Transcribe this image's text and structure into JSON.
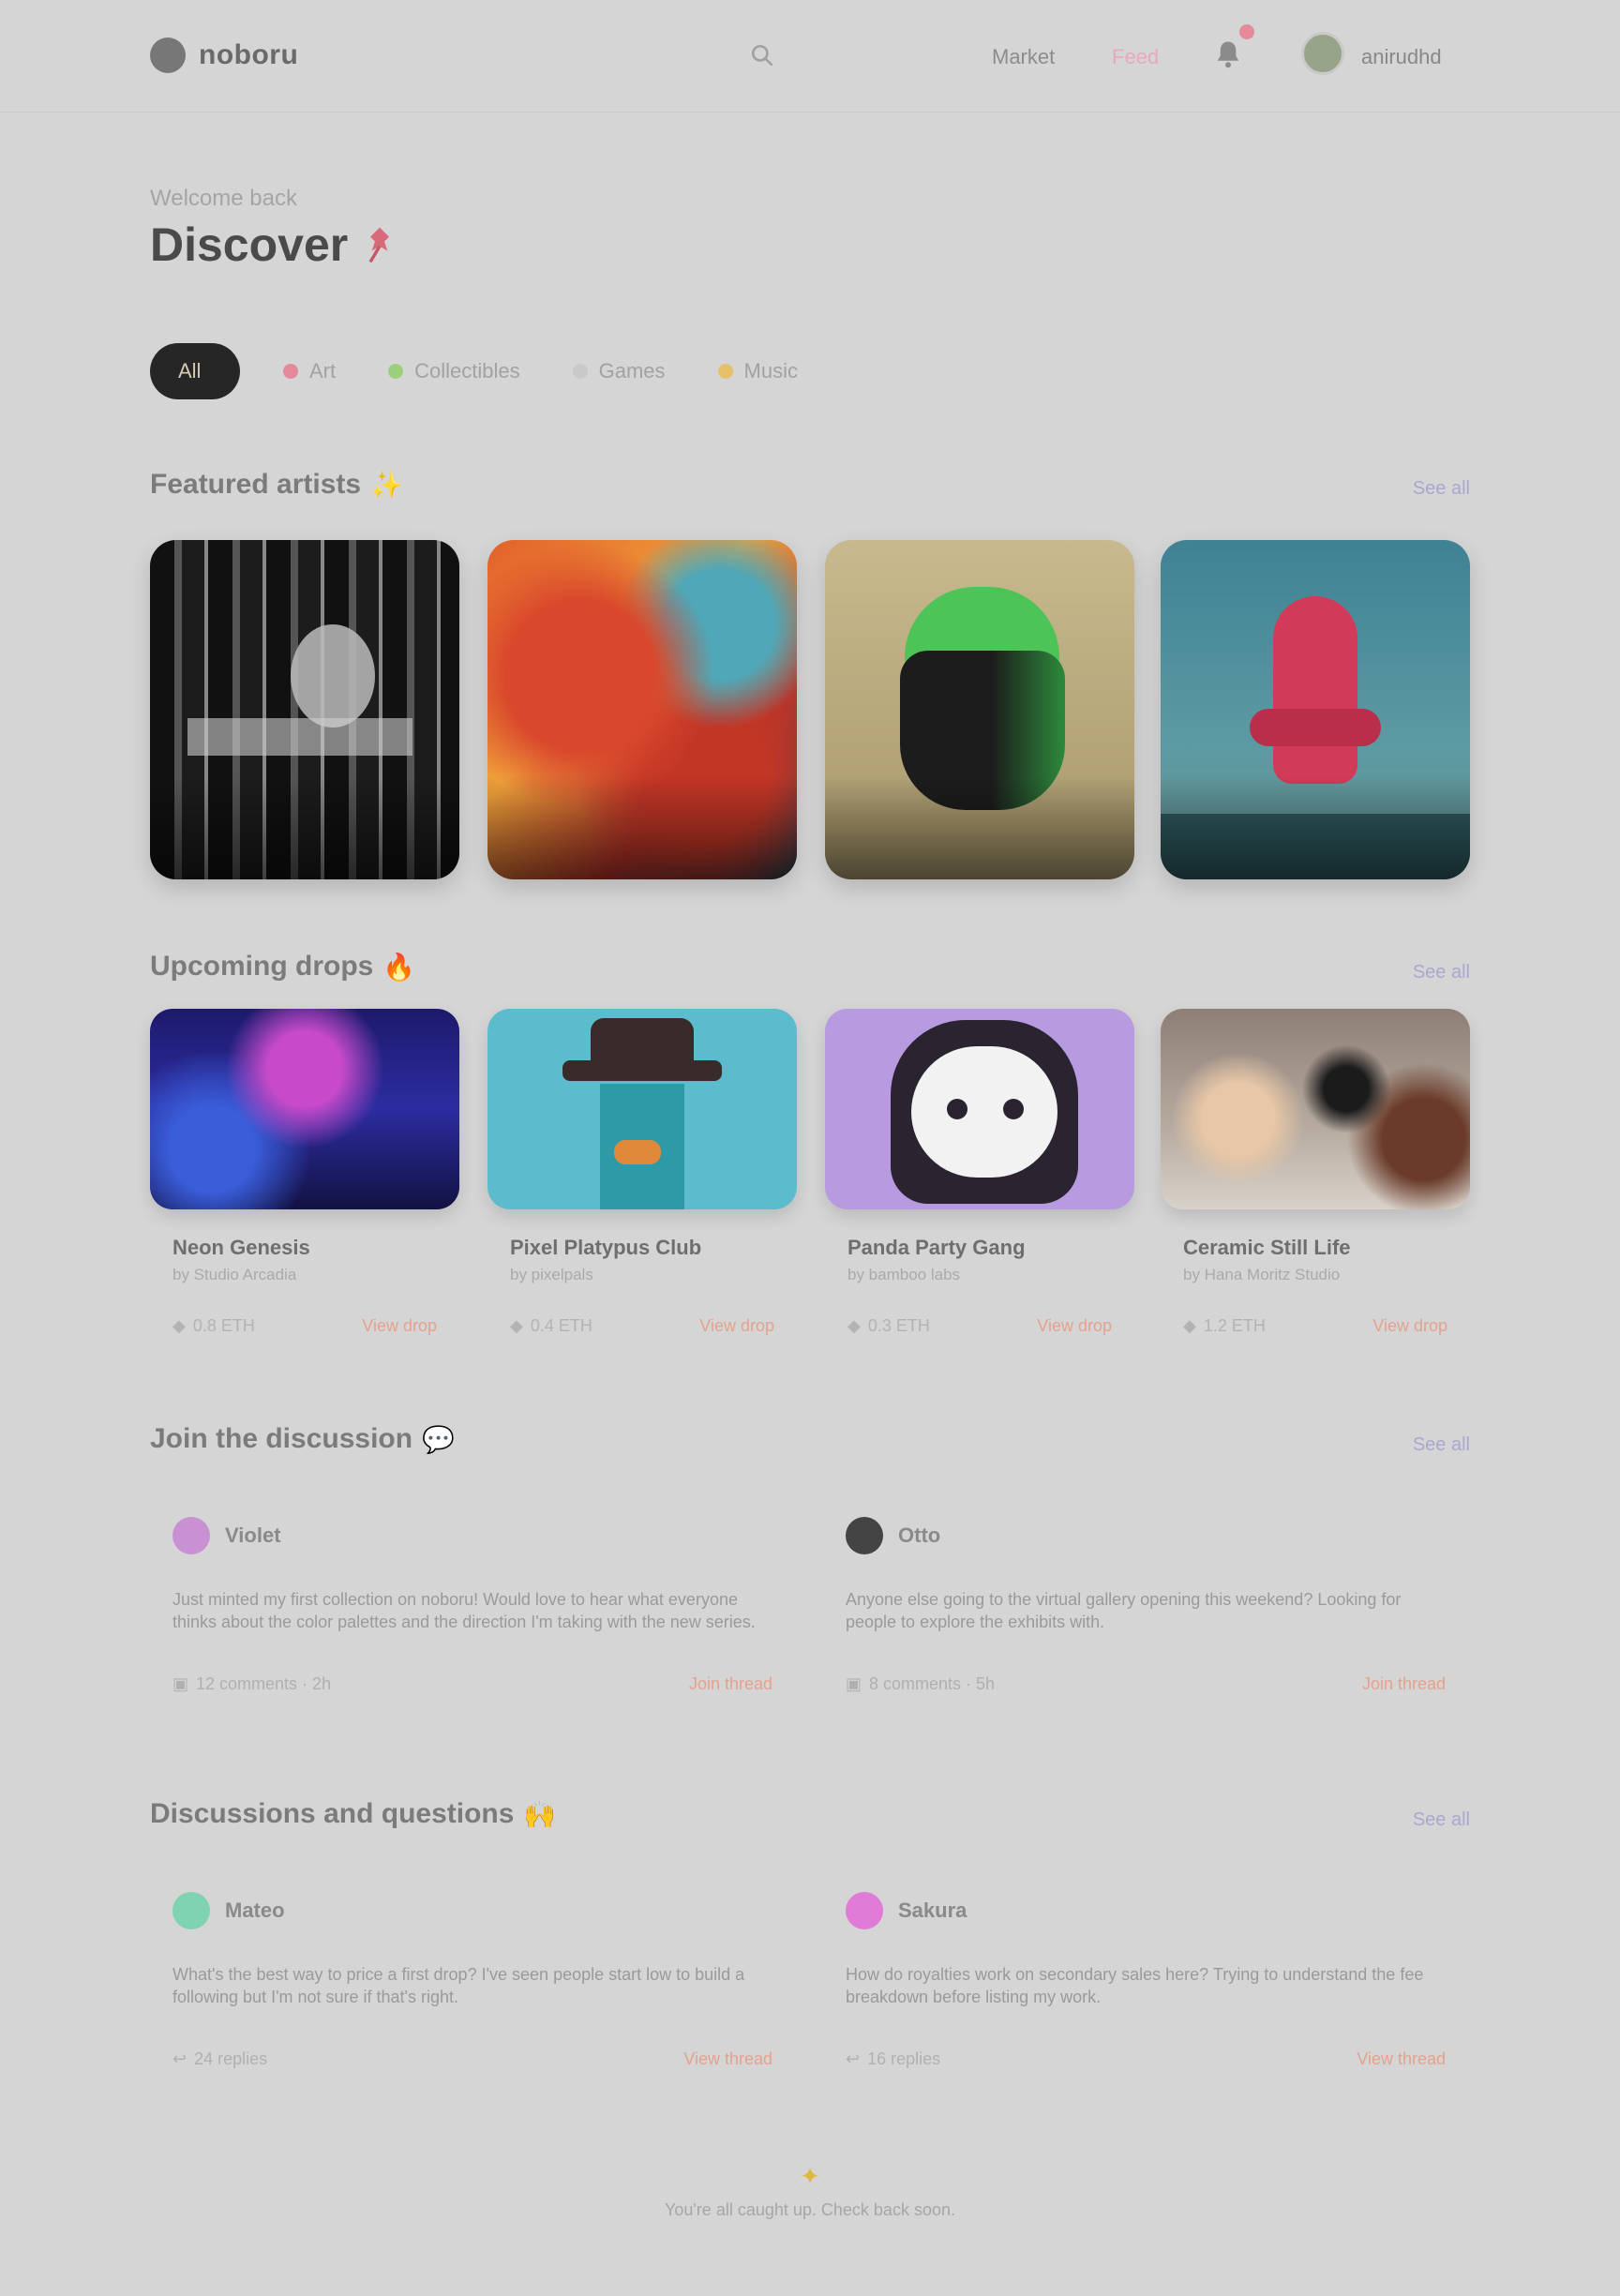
{
  "header": {
    "logo_text": "noboru",
    "nav": [
      {
        "label": "Market"
      },
      {
        "label": "Feed"
      }
    ],
    "user_name": "anirudhd"
  },
  "hero": {
    "welcome": "Welcome back",
    "title": "Discover",
    "title_emoji": "pin-icon"
  },
  "filters": [
    {
      "label": "All",
      "active": true,
      "color": "#262626"
    },
    {
      "label": "Art",
      "active": false,
      "color": "#e58a9a"
    },
    {
      "label": "Collectibles",
      "active": false,
      "color": "#9ccf7b"
    },
    {
      "label": "Games",
      "active": false,
      "color": "#cfcfcf"
    },
    {
      "label": "Music",
      "active": false,
      "color": "#e6c06a"
    }
  ],
  "sections": {
    "featured": {
      "title": "Featured artists",
      "emoji": "✨",
      "see_all": "See all"
    },
    "trending": {
      "title": "Upcoming drops",
      "emoji": "🔥",
      "see_all": "See all"
    },
    "latest": {
      "title": "Join the discussion",
      "emoji": "💬",
      "see_all": "See all"
    },
    "community": {
      "title": "Discussions and questions",
      "emoji": "🙌",
      "see_all": "See all"
    }
  },
  "featured_cards": [
    {
      "name": "featured-card-1",
      "art": "monochrome"
    },
    {
      "name": "featured-card-2",
      "art": "orange"
    },
    {
      "name": "featured-card-3",
      "art": "green"
    },
    {
      "name": "featured-card-4",
      "art": "teal"
    }
  ],
  "trending_cards": [
    {
      "title": "Neon Genesis",
      "subtitle": "by Studio Arcadia",
      "price": "0.8 ETH",
      "link": "View drop"
    },
    {
      "title": "Pixel Platypus Club",
      "subtitle": "by pixelpals",
      "price": "0.4 ETH",
      "link": "View drop"
    },
    {
      "title": "Panda Party Gang",
      "subtitle": "by bamboo labs",
      "price": "0.3 ETH",
      "link": "View drop"
    },
    {
      "title": "Ceramic Still Life",
      "subtitle": "by Hana Moritz Studio",
      "price": "1.2 ETH",
      "link": "View drop"
    }
  ],
  "latest_posts": [
    {
      "author": "Violet",
      "avatar_color": "#c791d4",
      "text": "Just minted my first collection on noboru! Would love to hear what everyone thinks about the color palettes and the direction I'm taking with the new series.",
      "meta": "12 comments · 2h",
      "link": "Join thread"
    },
    {
      "author": "Otto",
      "avatar_color": "#444444",
      "text": "Anyone else going to the virtual gallery opening this weekend? Looking for people to explore the exhibits with.",
      "meta": "8 comments · 5h",
      "link": "Join thread"
    }
  ],
  "community_posts": [
    {
      "author": "Mateo",
      "avatar_color": "#7fd3b0",
      "text": "What's the best way to price a first drop? I've seen people start low to build a following but I'm not sure if that's right.",
      "meta": "24 replies",
      "link": "View thread"
    },
    {
      "author": "Sakura",
      "avatar_color": "#e07bd8",
      "text": "How do royalties work on secondary sales here? Trying to understand the fee breakdown before listing my work.",
      "meta": "16 replies",
      "link": "View thread"
    }
  ],
  "footer": {
    "icon": "sparkle-icon",
    "text": "You're all caught up. Check back soon."
  }
}
